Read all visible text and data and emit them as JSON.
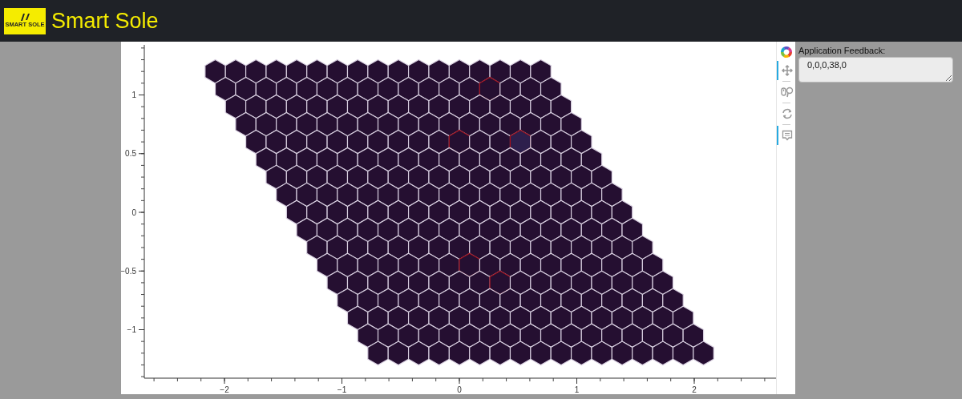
{
  "header": {
    "logo_text": "SMART SOLE",
    "title": "Smart Sole"
  },
  "plot": {
    "y_tick_labels": [
      "1",
      "0.5",
      "0",
      "−0.5",
      "−1"
    ],
    "x_tick_labels": [
      "−2",
      "−1",
      "0",
      "1",
      "2"
    ]
  },
  "toolbar": {
    "tools": [
      {
        "kind": "pan",
        "active": true
      },
      {
        "kind": "wheel_zoom",
        "active": false
      },
      {
        "kind": "reset",
        "active": false
      },
      {
        "kind": "hover",
        "active": true
      }
    ]
  },
  "feedback": {
    "label": "Application Feedback:",
    "value": "0,0,0,38,0"
  }
}
